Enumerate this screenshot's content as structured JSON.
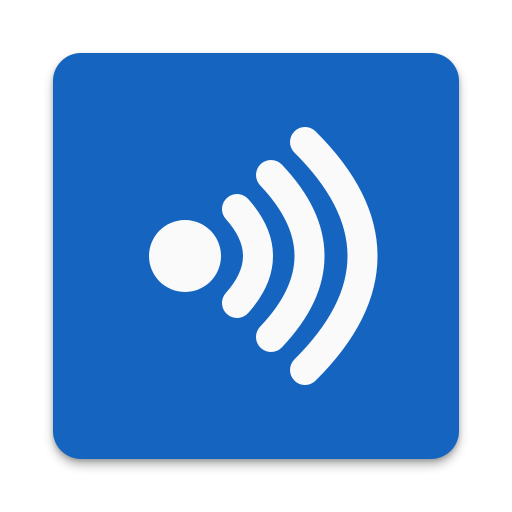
{
  "icon": {
    "name": "broadcast-signal-icon",
    "background_color": "#1565c0",
    "foreground_color": "#fafafa",
    "page_background": "#ffffff"
  }
}
